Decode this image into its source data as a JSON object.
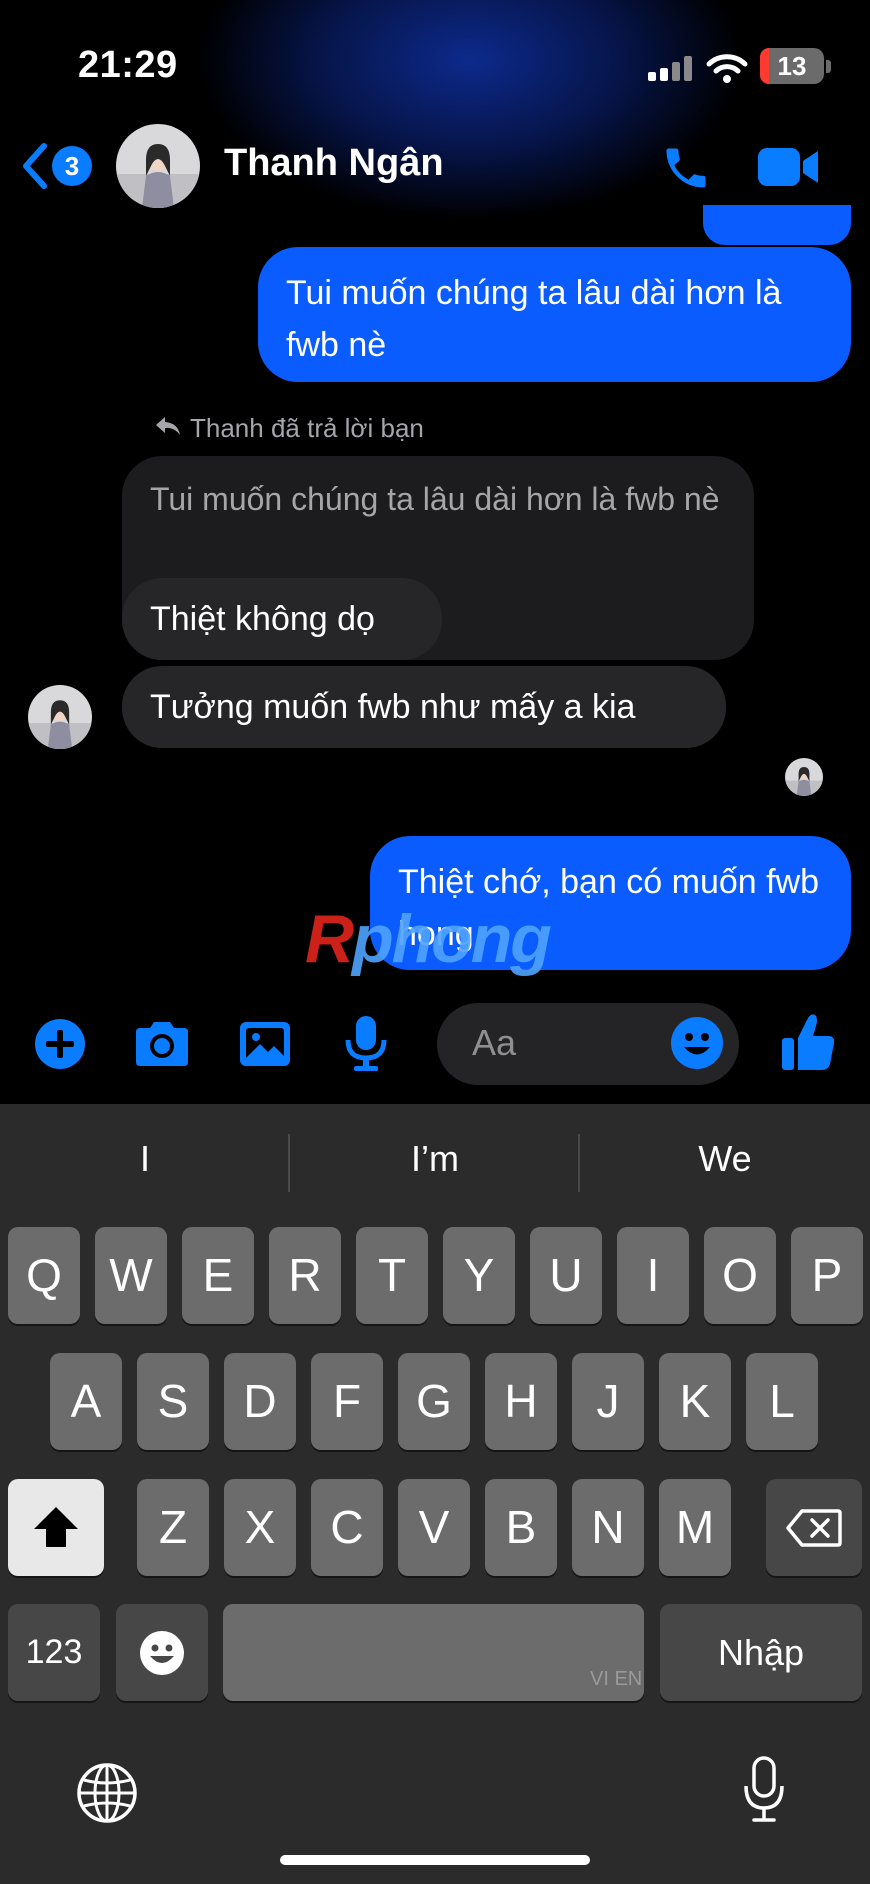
{
  "status_bar": {
    "time": "21:29",
    "battery": "13"
  },
  "header": {
    "back_badge": "3",
    "contact_name": "Thanh Ngân",
    "icons": [
      "back-chevron-icon",
      "phone-icon",
      "video-camera-icon"
    ]
  },
  "messages": [
    {
      "direction": "out",
      "text": "Tui muốn chúng ta lâu dài hơn là fwb nè"
    },
    {
      "direction": "in",
      "reply_note": "Thanh đã trả lời bạn",
      "quoted": "Tui muốn chúng ta lâu dài hơn là fwb nè",
      "text": "Thiệt không dọ"
    },
    {
      "direction": "in",
      "text": "Tưởng muốn fwb như mấy a kia"
    },
    {
      "direction": "out",
      "text": "Thiệt chớ, bạn có muốn fwb hong"
    }
  ],
  "watermark": {
    "part1": "R",
    "part2": "phong"
  },
  "composer": {
    "placeholder": "Aa",
    "icons": [
      "plus-icon",
      "camera-icon",
      "gallery-icon",
      "microphone-icon",
      "emoji-icon",
      "thumbs-up-icon"
    ]
  },
  "keyboard": {
    "suggestions": [
      "I",
      "I’m",
      "We"
    ],
    "rows": [
      [
        "Q",
        "W",
        "E",
        "R",
        "T",
        "Y",
        "U",
        "I",
        "O",
        "P"
      ],
      [
        "A",
        "S",
        "D",
        "F",
        "G",
        "H",
        "J",
        "K",
        "L"
      ],
      [
        "Z",
        "X",
        "C",
        "V",
        "B",
        "N",
        "M"
      ]
    ],
    "numbers_label": "123",
    "return_label": "Nhập",
    "space_lang": "VI EN"
  },
  "colors": {
    "outgoing_bubble": "#0a5cff",
    "incoming_bubble": "#262628",
    "accent": "#0a7cff",
    "keyboard_bg": "#2b2b2b"
  }
}
